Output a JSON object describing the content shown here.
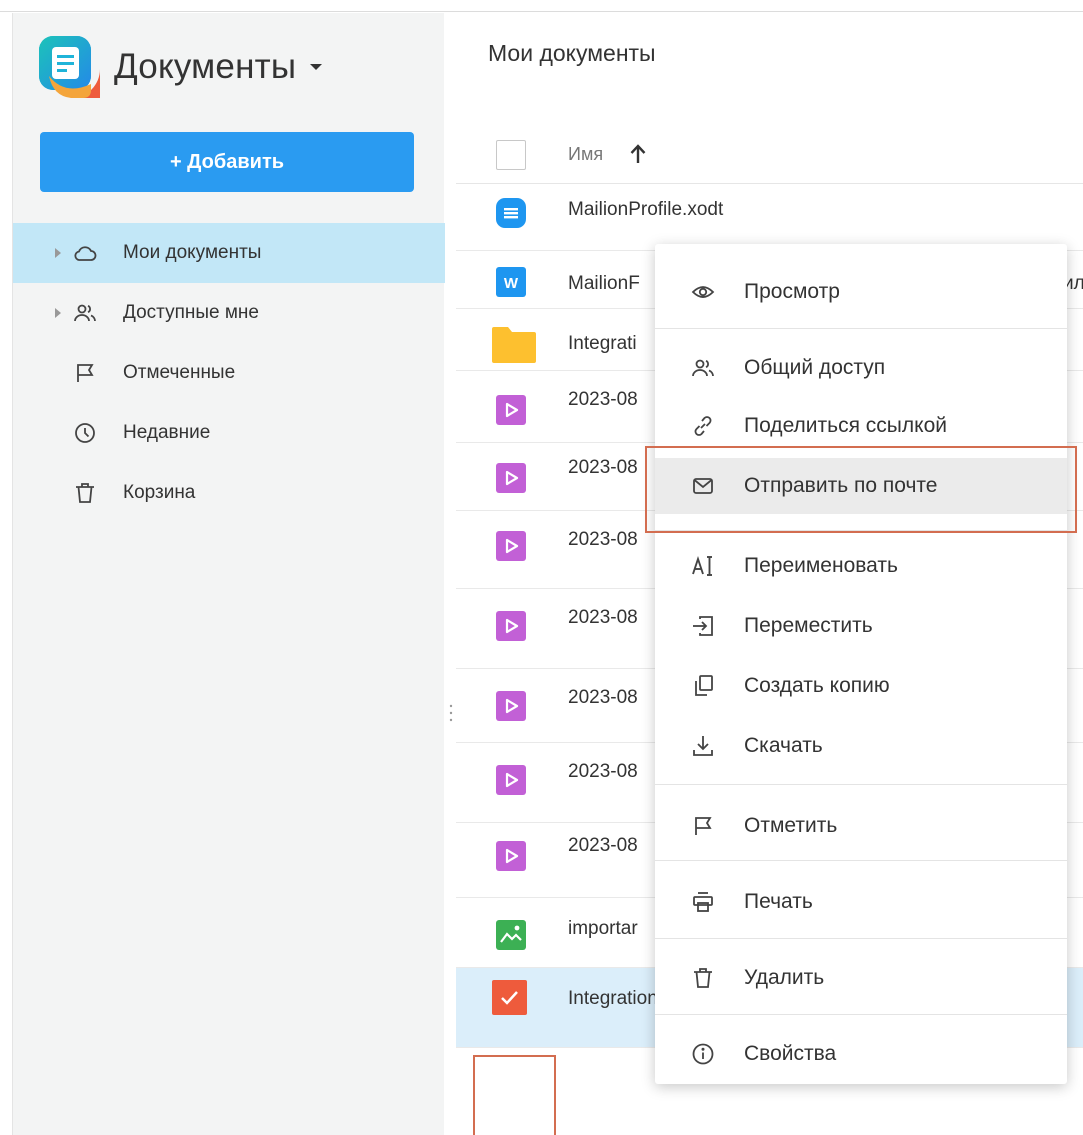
{
  "app": {
    "name": "Документы"
  },
  "sidebar": {
    "add_label": "+ Добавить",
    "items": [
      {
        "label": "Мои документы",
        "icon": "cloud-icon"
      },
      {
        "label": "Доступные мне",
        "icon": "users-icon"
      },
      {
        "label": "Отмеченные",
        "icon": "flag-icon"
      },
      {
        "label": "Недавние",
        "icon": "clock-icon"
      },
      {
        "label": "Корзина",
        "icon": "trash-icon"
      }
    ]
  },
  "main": {
    "title": "Мои документы",
    "column_name": "Имя",
    "files": [
      {
        "name": "MailionProfile.xodt",
        "icon": "text-document-icon"
      },
      {
        "name": "MailionF",
        "trailing": "ил",
        "icon": "word-document-icon"
      },
      {
        "name": "Integrati",
        "icon": "folder-icon"
      },
      {
        "name": "2023-08",
        "icon": "video-file-icon"
      },
      {
        "name": "2023-08",
        "icon": "video-file-icon"
      },
      {
        "name": "2023-08",
        "icon": "video-file-icon"
      },
      {
        "name": "2023-08",
        "icon": "video-file-icon"
      },
      {
        "name": "2023-08",
        "icon": "video-file-icon"
      },
      {
        "name": "2023-08",
        "icon": "video-file-icon"
      },
      {
        "name": "2023-08",
        "icon": "video-file-icon"
      },
      {
        "name": "importar",
        "icon": "image-file-icon"
      },
      {
        "name": "Integration_Mailion_MyOffice_Private_Cloud.pdf",
        "icon": "checkbox-checked-icon"
      }
    ]
  },
  "context_menu": {
    "items": [
      {
        "label": "Просмотр",
        "icon": "eye-icon"
      },
      {
        "label": "Общий доступ",
        "icon": "users-icon"
      },
      {
        "label": "Поделиться ссылкой",
        "icon": "link-icon"
      },
      {
        "label": "Отправить по почте",
        "icon": "mail-icon"
      },
      {
        "label": "Переименовать",
        "icon": "rename-icon"
      },
      {
        "label": "Переместить",
        "icon": "move-icon"
      },
      {
        "label": "Создать копию",
        "icon": "copy-icon"
      },
      {
        "label": "Скачать",
        "icon": "download-icon"
      },
      {
        "label": "Отметить",
        "icon": "flag-icon"
      },
      {
        "label": "Печать",
        "icon": "printer-icon"
      },
      {
        "label": "Удалить",
        "icon": "trash-icon"
      },
      {
        "label": "Свойства",
        "icon": "info-icon"
      }
    ]
  },
  "colors": {
    "accent": "#2a9bf1",
    "active_nav": "#c2e7f7",
    "highlight_frame": "#d36d50",
    "video_icon": "#c260d6",
    "folder": "#fdc02f"
  }
}
